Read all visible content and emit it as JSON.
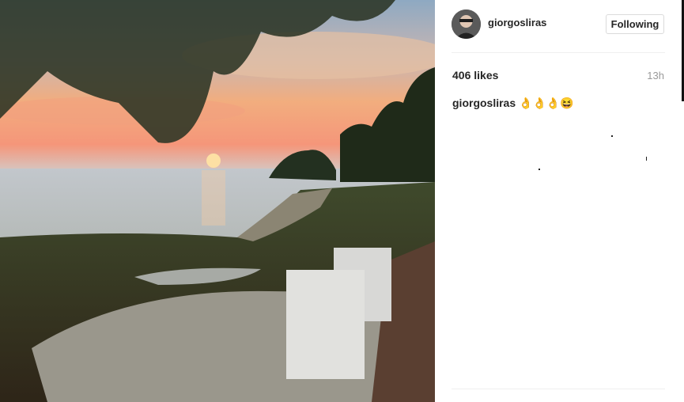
{
  "post": {
    "username": "giorgosliras",
    "follow_label": "Following",
    "likes": "406 likes",
    "time": "13h",
    "caption_author": "giorgosliras",
    "caption_text": " 👌👌👌😆"
  },
  "icons": {
    "avatar": "user-avatar"
  },
  "colors": {
    "text": "#262626",
    "muted": "#999999",
    "border": "#dbdbdb"
  }
}
